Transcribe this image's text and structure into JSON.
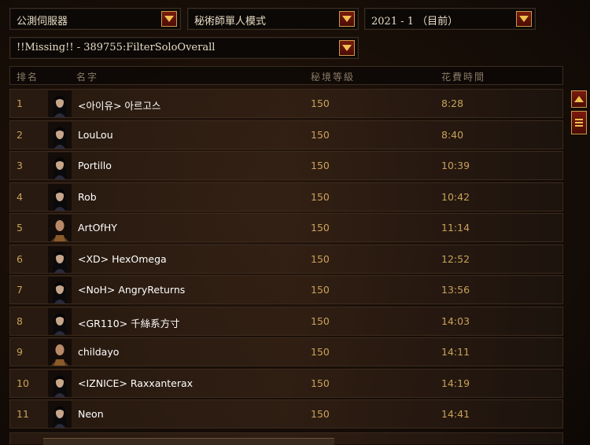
{
  "filters": {
    "server": "公測伺服器",
    "mode": "秘術師單人模式",
    "season": "2021 - 1 （目前）",
    "leaderboard": "!!Missing!! - 389755:FilterSoloOverall"
  },
  "columns": {
    "rank": "排名",
    "name": "名字",
    "level": "秘境等級",
    "time": "花費時間"
  },
  "rows": [
    {
      "rank": "1",
      "name": "<아이유> 아르고스",
      "level": "150",
      "time": "8:28",
      "avatar": "female"
    },
    {
      "rank": "2",
      "name": "LouLou",
      "level": "150",
      "time": "8:40",
      "avatar": "female"
    },
    {
      "rank": "3",
      "name": "Portillo",
      "level": "150",
      "time": "10:39",
      "avatar": "female"
    },
    {
      "rank": "4",
      "name": "Rob",
      "level": "150",
      "time": "10:42",
      "avatar": "female"
    },
    {
      "rank": "5",
      "name": "ArtOfHY",
      "level": "150",
      "time": "11:14",
      "avatar": "male"
    },
    {
      "rank": "6",
      "name": "<XD> HexOmega",
      "level": "150",
      "time": "12:52",
      "avatar": "female"
    },
    {
      "rank": "7",
      "name": "<NoH> AngryReturns",
      "level": "150",
      "time": "13:56",
      "avatar": "female"
    },
    {
      "rank": "8",
      "name": "<GR110> 千絲系方寸",
      "level": "150",
      "time": "14:03",
      "avatar": "female"
    },
    {
      "rank": "9",
      "name": "childayo",
      "level": "150",
      "time": "14:11",
      "avatar": "male"
    },
    {
      "rank": "10",
      "name": "<IZNICE> Raxxanterax",
      "level": "150",
      "time": "14:19",
      "avatar": "female"
    },
    {
      "rank": "11",
      "name": "Neon",
      "level": "150",
      "time": "14:41",
      "avatar": "female"
    }
  ],
  "colors": {
    "accent_gold": "#c9a15a",
    "button_red": "#7a1a0e",
    "name_white": "#ffffff"
  },
  "icons": {
    "dropdown": "chevron-down-icon",
    "scroll_up": "scroll-up-icon",
    "scroll_thumb": "scroll-thumb-icon"
  }
}
